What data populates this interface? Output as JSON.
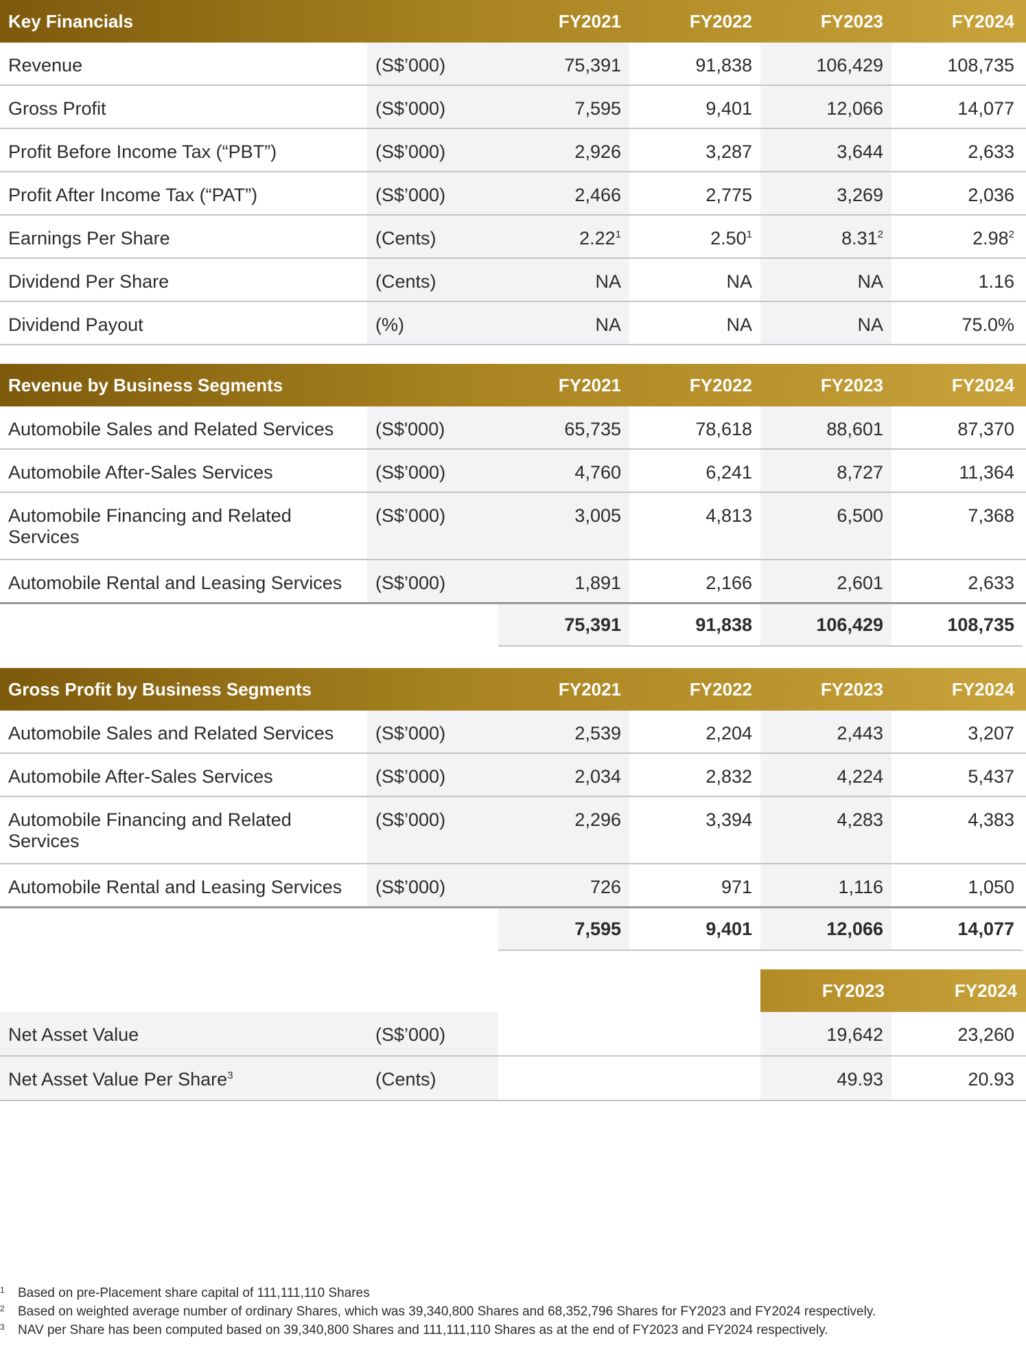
{
  "years": [
    "FY2021",
    "FY2022",
    "FY2023",
    "FY2024"
  ],
  "key_financials": {
    "title": "Key Financials",
    "rows": [
      {
        "label": "Revenue",
        "unit": "(S$’000)",
        "v": [
          "75,391",
          "91,838",
          "106,429",
          "108,735"
        ]
      },
      {
        "label": "Gross Profit",
        "unit": "(S$’000)",
        "v": [
          "7,595",
          "9,401",
          "12,066",
          "14,077"
        ]
      },
      {
        "label": "Profit Before Income Tax (“PBT”)",
        "unit": "(S$’000)",
        "v": [
          "2,926",
          "3,287",
          "3,644",
          "2,633"
        ]
      },
      {
        "label": "Profit After Income Tax (“PAT”)",
        "unit": "(S$’000)",
        "v": [
          "2,466",
          "2,775",
          "3,269",
          "2,036"
        ]
      },
      {
        "label": "Earnings Per Share",
        "unit": "(Cents)",
        "v": [
          "2.22",
          "2.50",
          "8.31",
          "2.98"
        ],
        "sup": [
          "1",
          "1",
          "2",
          "2"
        ]
      },
      {
        "label": "Dividend Per Share",
        "unit": "(Cents)",
        "v": [
          "NA",
          "NA",
          "NA",
          "1.16"
        ]
      },
      {
        "label": "Dividend Payout",
        "unit": "(%)",
        "v": [
          "NA",
          "NA",
          "NA",
          "75.0%"
        ]
      }
    ]
  },
  "revenue_segments": {
    "title": "Revenue by Business Segments",
    "rows": [
      {
        "label": "Automobile Sales and Related Services",
        "unit": "(S$'000)",
        "v": [
          "65,735",
          "78,618",
          "88,601",
          "87,370"
        ]
      },
      {
        "label": "Automobile After-Sales Services",
        "unit": "(S$’000)",
        "v": [
          "4,760",
          "6,241",
          "8,727",
          "11,364"
        ]
      },
      {
        "label": "Automobile Financing and Related",
        "label2": "Services",
        "unit": "(S$’000)",
        "v": [
          "3,005",
          "4,813",
          "6,500",
          "7,368"
        ]
      },
      {
        "label": "Automobile Rental and Leasing Services",
        "unit": "(S$’000)",
        "v": [
          "1,891",
          "2,166",
          "2,601",
          "2,633"
        ]
      }
    ],
    "total": [
      "75,391",
      "91,838",
      "106,429",
      "108,735"
    ]
  },
  "gross_profit_segments": {
    "title": "Gross Profit by Business Segments",
    "rows": [
      {
        "label": "Automobile Sales and Related Services",
        "unit": "(S$’000)",
        "v": [
          "2,539",
          "2,204",
          "2,443",
          "3,207"
        ]
      },
      {
        "label": "Automobile After-Sales Services",
        "unit": "(S$’000)",
        "v": [
          "2,034",
          "2,832",
          "4,224",
          "5,437"
        ]
      },
      {
        "label": "Automobile Financing and Related",
        "label2": "Services",
        "unit": "(S$’000)",
        "v": [
          "2,296",
          "3,394",
          "4,283",
          "4,383"
        ]
      },
      {
        "label": "Automobile Rental and Leasing Services",
        "unit": "(S$’000)",
        "v": [
          "726",
          "971",
          "1,116",
          "1,050"
        ]
      }
    ],
    "total": [
      "7,595",
      "9,401",
      "12,066",
      "14,077"
    ]
  },
  "nav": {
    "years": [
      "FY2023",
      "FY2024"
    ],
    "rows": [
      {
        "label": "Net Asset Value",
        "unit": "(S$’000)",
        "v": [
          "19,642",
          "23,260"
        ]
      },
      {
        "label": "Net Asset Value Per Share",
        "sup": "3",
        "unit": "(Cents)",
        "v": [
          "49.93",
          "20.93"
        ]
      }
    ]
  },
  "footnotes": [
    {
      "mark": "1",
      "text": "Based on pre-Placement share capital of 111,111,110 Shares"
    },
    {
      "mark": "2",
      "text": "Based on weighted average number of ordinary Shares, which was 39,340,800 Shares and 68,352,796 Shares for FY2023 and FY2024 respectively."
    },
    {
      "mark": "3",
      "text": "NAV per Share has been computed based on 39,340,800 Shares and 111,111,110 Shares as at the end of FY2023 and FY2024 respectively."
    }
  ],
  "colors": {
    "header_dark": "#7d5a0c",
    "header_light": "#c8a23a",
    "stripe": "#f3f3f5"
  }
}
